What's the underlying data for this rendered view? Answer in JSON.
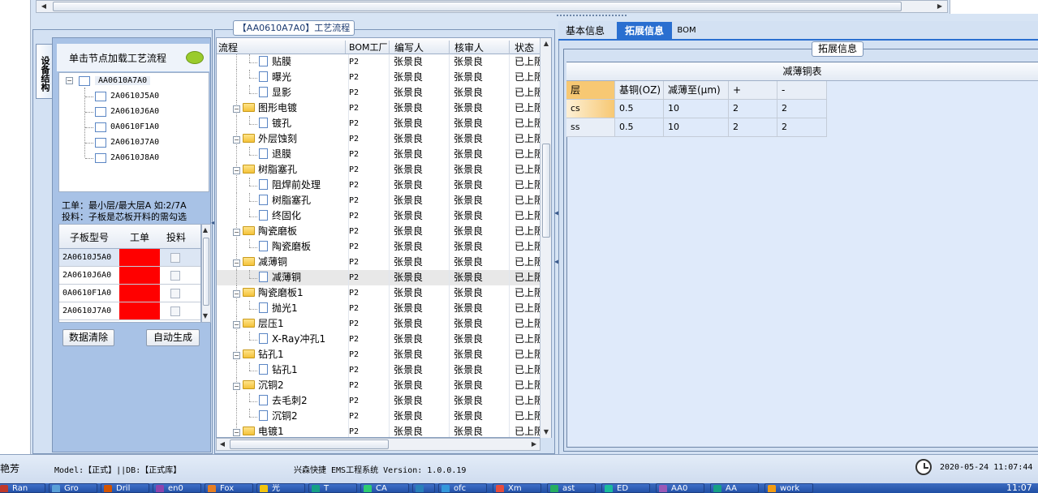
{
  "top_bar": {
    "right_blank": ""
  },
  "process_panel": {
    "title": "【AA0610A7A0】工艺流程",
    "columns": [
      "流程",
      "BOM工厂",
      "编写人",
      "核审人",
      "状态"
    ],
    "rows": [
      {
        "indent": 2,
        "kind": "doc",
        "name": "贴膜",
        "bom": "P2",
        "author": "张景良",
        "reviewer": "张景良",
        "status": "已上阪"
      },
      {
        "indent": 2,
        "kind": "doc",
        "name": "曝光",
        "bom": "P2",
        "author": "张景良",
        "reviewer": "张景良",
        "status": "已上阪"
      },
      {
        "indent": 2,
        "kind": "doc",
        "name": "显影",
        "bom": "P2",
        "author": "张景良",
        "reviewer": "张景良",
        "status": "已上阪"
      },
      {
        "indent": 1,
        "kind": "folder",
        "name": "图形电镀",
        "bom": "P2",
        "author": "张景良",
        "reviewer": "张景良",
        "status": "已上阪"
      },
      {
        "indent": 2,
        "kind": "doc",
        "name": "镀孔",
        "bom": "P2",
        "author": "张景良",
        "reviewer": "张景良",
        "status": "已上阪"
      },
      {
        "indent": 1,
        "kind": "folder",
        "name": "外层蚀刻",
        "bom": "P2",
        "author": "张景良",
        "reviewer": "张景良",
        "status": "已上阪"
      },
      {
        "indent": 2,
        "kind": "doc",
        "name": "退膜",
        "bom": "P2",
        "author": "张景良",
        "reviewer": "张景良",
        "status": "已上阪"
      },
      {
        "indent": 1,
        "kind": "folder",
        "name": "树脂塞孔",
        "bom": "P2",
        "author": "张景良",
        "reviewer": "张景良",
        "status": "已上阪"
      },
      {
        "indent": 2,
        "kind": "doc",
        "name": "阻焊前处理",
        "bom": "P2",
        "author": "张景良",
        "reviewer": "张景良",
        "status": "已上阪"
      },
      {
        "indent": 2,
        "kind": "doc",
        "name": "树脂塞孔",
        "bom": "P2",
        "author": "张景良",
        "reviewer": "张景良",
        "status": "已上阪"
      },
      {
        "indent": 2,
        "kind": "doc",
        "name": "终固化",
        "bom": "P2",
        "author": "张景良",
        "reviewer": "张景良",
        "status": "已上阪"
      },
      {
        "indent": 1,
        "kind": "folder",
        "name": "陶瓷磨板",
        "bom": "P2",
        "author": "张景良",
        "reviewer": "张景良",
        "status": "已上阪"
      },
      {
        "indent": 2,
        "kind": "doc",
        "name": "陶瓷磨板",
        "bom": "P2",
        "author": "张景良",
        "reviewer": "张景良",
        "status": "已上阪"
      },
      {
        "indent": 1,
        "kind": "folder",
        "name": "减薄铜",
        "bom": "P2",
        "author": "张景良",
        "reviewer": "张景良",
        "status": "已上阪"
      },
      {
        "indent": 2,
        "kind": "doc",
        "name": "减薄铜",
        "bom": "P2",
        "author": "张景良",
        "reviewer": "张景良",
        "status": "已上阪",
        "selected": true
      },
      {
        "indent": 1,
        "kind": "folder",
        "name": "陶瓷磨板1",
        "bom": "P2",
        "author": "张景良",
        "reviewer": "张景良",
        "status": "已上阪"
      },
      {
        "indent": 2,
        "kind": "doc",
        "name": "抛光1",
        "bom": "P2",
        "author": "张景良",
        "reviewer": "张景良",
        "status": "已上阪"
      },
      {
        "indent": 1,
        "kind": "folder",
        "name": "层压1",
        "bom": "P2",
        "author": "张景良",
        "reviewer": "张景良",
        "status": "已上阪"
      },
      {
        "indent": 2,
        "kind": "doc",
        "name": "X-Ray冲孔1",
        "bom": "P2",
        "author": "张景良",
        "reviewer": "张景良",
        "status": "已上阪"
      },
      {
        "indent": 1,
        "kind": "folder",
        "name": "钻孔1",
        "bom": "P2",
        "author": "张景良",
        "reviewer": "张景良",
        "status": "已上阪"
      },
      {
        "indent": 2,
        "kind": "doc",
        "name": "钻孔1",
        "bom": "P2",
        "author": "张景良",
        "reviewer": "张景良",
        "status": "已上阪"
      },
      {
        "indent": 1,
        "kind": "folder",
        "name": "沉铜2",
        "bom": "P2",
        "author": "张景良",
        "reviewer": "张景良",
        "status": "已上阪"
      },
      {
        "indent": 2,
        "kind": "doc",
        "name": "去毛刺2",
        "bom": "P2",
        "author": "张景良",
        "reviewer": "张景良",
        "status": "已上阪"
      },
      {
        "indent": 2,
        "kind": "doc",
        "name": "沉铜2",
        "bom": "P2",
        "author": "张景良",
        "reviewer": "张景良",
        "status": "已上阪"
      },
      {
        "indent": 1,
        "kind": "folder",
        "name": "电镀1",
        "bom": "P2",
        "author": "张景良",
        "reviewer": "张景良",
        "status": "已上阪"
      }
    ]
  },
  "left_panel": {
    "vertical_tab": "设备结构",
    "load_hint": "单击节点加载工艺流程",
    "tree_root": "AA0610A7A0",
    "tree_children": [
      "2A0610J5A0",
      "2A0610J6A0",
      "0A0610F1A0",
      "2A0610J7A0",
      "2A0610J8A0"
    ],
    "note_line1": "工单：最小层/最大层A 如:2/7A",
    "note_line2": "投料：子板是芯板开料的需勾选",
    "grid_headers": [
      "子板型号",
      "工单",
      "投料"
    ],
    "grid_rows": [
      {
        "model": "2A0610J5A0",
        "order_color": "#ff0000"
      },
      {
        "model": "2A0610J6A0",
        "order_color": "#ff0000"
      },
      {
        "model": "0A0610F1A0",
        "order_color": "#ff0000"
      },
      {
        "model": "2A0610J7A0",
        "order_color": "#ff0000"
      }
    ],
    "btn_clear": "数据清除",
    "btn_auto": "自动生成"
  },
  "right_panel": {
    "tabs": [
      "基本信息",
      "拓展信息",
      "BOM"
    ],
    "active_tab": "拓展信息",
    "group_title": "拓展信息",
    "table_title": "减薄铜表",
    "headers": [
      "层",
      "基铜(OZ)",
      "减薄至(μm)",
      "+",
      "-"
    ],
    "rows": [
      [
        "cs",
        "0.5",
        "10",
        "2",
        "2"
      ],
      [
        "ss",
        "0.5",
        "10",
        "2",
        "2"
      ]
    ]
  },
  "status_bar": {
    "user": "艳芳",
    "model": "Model:【正式】||DB:【正式库】",
    "app": "兴森快捷 EMS工程系统 Version: 1.0.0.19",
    "datetime": "2020-05-24 11:07:44"
  },
  "taskbar": {
    "items": [
      "Ran",
      "Gro",
      "Dril",
      "en0",
      "Fox",
      "光",
      "T",
      "CA",
      "",
      "ofc",
      "Xm",
      "ast",
      "ED",
      "AA0",
      "AA",
      "work"
    ],
    "time": "11:07"
  },
  "colors": {
    "accent": "#1e6fd0",
    "selected_tab": "#2a6fd0",
    "red": "#ff0000",
    "header_orange": "#f7c873"
  }
}
